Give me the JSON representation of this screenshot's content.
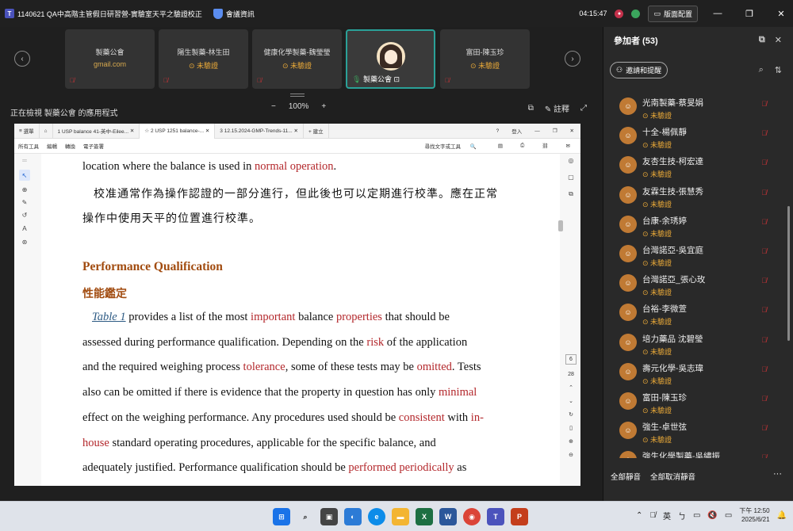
{
  "window": {
    "title": "1140621 QA中高階主管假日研習營-實驗室天平之驗證校正",
    "meeting_info": "會議資訊",
    "timer": "04:15:47",
    "layout_label": "版面配置"
  },
  "tiles": [
    {
      "name": "製藥公會",
      "sub": "gmail.com"
    },
    {
      "name": "陽生製藥-林生田",
      "sub": "未驗證"
    },
    {
      "name": "健康化學製藥-魏瑩瑩",
      "sub": "未驗證"
    },
    {
      "name": "製藥公會",
      "sub": ""
    },
    {
      "name": "富田-陳玉珍",
      "sub": "未驗證"
    }
  ],
  "share": {
    "viewing_label": "正在檢視 製藥公會 的應用程式",
    "zoom_out": "−",
    "zoom_value": "100%",
    "zoom_in": "+",
    "annotate_label": "註釋"
  },
  "pdf": {
    "tabs": [
      "選單",
      "1 USP balance 41-英中-Eilee...",
      "2 USP 1251 balance-...",
      "3 12.15.2024-GMP-Trends-11...",
      "+ 建立"
    ],
    "signin": "登入",
    "tools": [
      "所有工具",
      "編輯",
      "轉換",
      "電子簽署"
    ],
    "find_label": "尋找文字或工具",
    "page_num": "6",
    "page_total": "28",
    "lines": {
      "l1a": "location where the balance is used in ",
      "l1b": "normal operation",
      "l1c": ".",
      "l2": "校准通常作為操作認證的一部分進行，但此後也可以定期進行校準。應在正常",
      "l3": "操作中使用天平的位置進行校準。",
      "h1": "Performance Qualification",
      "h2": "性能鑑定",
      "p1a": "Table 1",
      "p1b": " provides a list of the most ",
      "p1c": "important",
      "p1d": " balance ",
      "p1e": "properties",
      "p1f": " that should be",
      "p2a": "assessed during performance qualification. Depending on the ",
      "p2b": "risk",
      "p2c": " of the application",
      "p3a": "and the required weighing process ",
      "p3b": "tolerance",
      "p3c": ", some of these tests may be ",
      "p3d": "omitted",
      "p3e": ". Tests",
      "p4a": "also can be omitted if there is evidence that the property in question has only ",
      "p4b": "minimal",
      "p5a": "effect on the weighing performance. Any procedures used should be ",
      "p5b": "consistent",
      "p5c": " with ",
      "p5d": "in-",
      "p6a": "house",
      "p6b": " standard operating procedures, applicable for the specific balance, and",
      "p7a": "adequately justified. Performance qualification should be ",
      "p7b": "performed periodically",
      "p7c": " as"
    }
  },
  "panel": {
    "title": "參加者 (53)",
    "invite_label": "邀請和提醒",
    "status_text": "未驗證",
    "participants": [
      "光南製藥-蔡旻娟",
      "十全-楊佩靜",
      "友杏生技-柯宏達",
      "友霖生技-張慧秀",
      "台康-余琇婷",
      "台灣諾亞-吳宜庭",
      "台灣諾亞_張心玫",
      "台裕-李微萱",
      "培力藥品 沈碧瑩",
      "壽元化學-吳志瑋",
      "富田-陳玉珍",
      "強生-卓世弦",
      "強生化學製藥-吳繡振"
    ],
    "mute_all": "全部靜音",
    "unmute_all": "全部取消靜音"
  },
  "taskbar": {
    "lang": "英",
    "time": "下午 12:50",
    "date": "2025/6/21"
  }
}
